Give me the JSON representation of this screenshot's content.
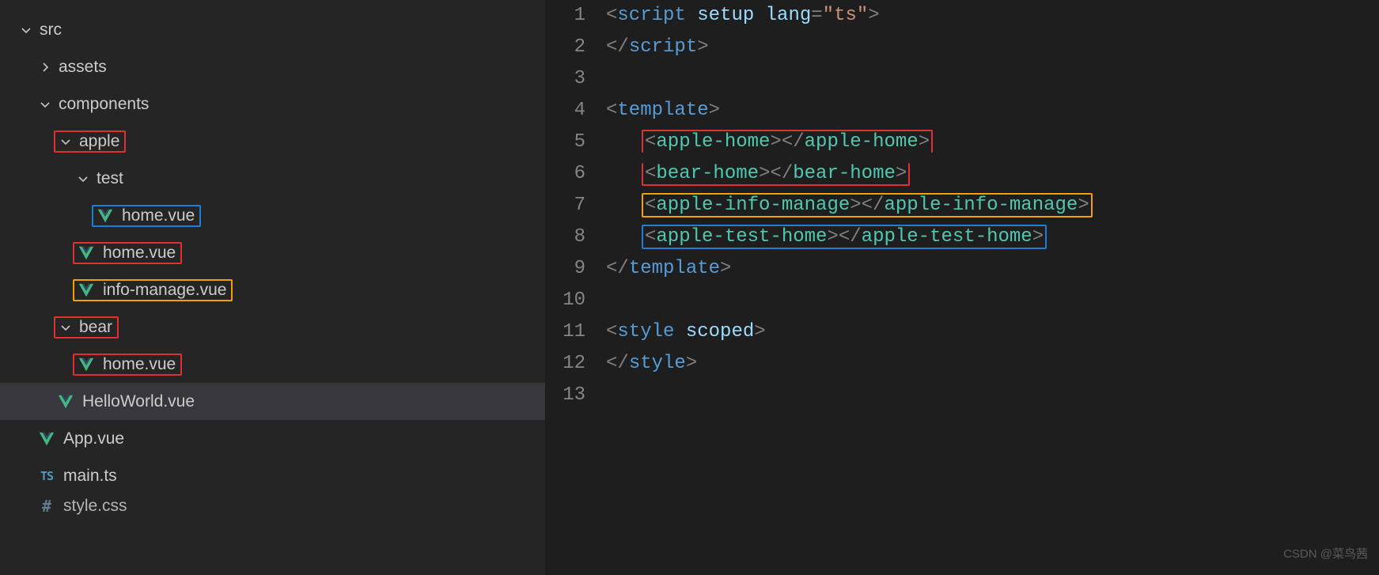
{
  "explorer": {
    "items": [
      {
        "type": "folder",
        "label": "src",
        "depth": 0,
        "expanded": true,
        "hl": null
      },
      {
        "type": "folder",
        "label": "assets",
        "depth": 1,
        "expanded": false,
        "hl": null
      },
      {
        "type": "folder",
        "label": "components",
        "depth": 1,
        "expanded": true,
        "hl": null
      },
      {
        "type": "folder",
        "label": "apple",
        "depth": 2,
        "expanded": true,
        "hl": "red"
      },
      {
        "type": "folder",
        "label": "test",
        "depth": 3,
        "expanded": true,
        "hl": null
      },
      {
        "type": "file",
        "label": "home.vue",
        "depth": 4,
        "icon": "vue",
        "hl": "blue"
      },
      {
        "type": "file",
        "label": "home.vue",
        "depth": 3,
        "icon": "vue",
        "hl": "red"
      },
      {
        "type": "file",
        "label": "info-manage.vue",
        "depth": 3,
        "icon": "vue",
        "hl": "yellow"
      },
      {
        "type": "folder",
        "label": "bear",
        "depth": 2,
        "expanded": true,
        "hl": "red"
      },
      {
        "type": "file",
        "label": "home.vue",
        "depth": 3,
        "icon": "vue",
        "hl": "red"
      },
      {
        "type": "file",
        "label": "HelloWorld.vue",
        "depth": 2,
        "icon": "vue",
        "hl": null,
        "selected": true
      },
      {
        "type": "file",
        "label": "App.vue",
        "depth": 1,
        "icon": "vue",
        "hl": null
      },
      {
        "type": "file",
        "label": "main.ts",
        "depth": 1,
        "icon": "ts",
        "hl": null
      },
      {
        "type": "file",
        "label": "style.css",
        "depth": 1,
        "icon": "hash",
        "hl": null,
        "cut": true
      }
    ]
  },
  "editor": {
    "lines": [
      {
        "n": 1,
        "segs": [
          {
            "t": "<",
            "c": "pun"
          },
          {
            "t": "script",
            "c": "tag"
          },
          {
            "t": " "
          },
          {
            "t": "setup",
            "c": "attn"
          },
          {
            "t": " "
          },
          {
            "t": "lang",
            "c": "attn"
          },
          {
            "t": "=",
            "c": "pun"
          },
          {
            "t": "\"ts\"",
            "c": "attv"
          },
          {
            "t": ">",
            "c": "pun"
          }
        ]
      },
      {
        "n": 2,
        "segs": [
          {
            "t": "</",
            "c": "pun"
          },
          {
            "t": "script",
            "c": "tag"
          },
          {
            "t": ">",
            "c": "pun"
          }
        ]
      },
      {
        "n": 3,
        "segs": []
      },
      {
        "n": 4,
        "segs": [
          {
            "t": "<",
            "c": "pun"
          },
          {
            "t": "template",
            "c": "tag"
          },
          {
            "t": ">",
            "c": "pun"
          }
        ]
      },
      {
        "n": 5,
        "guide": true,
        "indent": 1,
        "box": "red",
        "segs": [
          {
            "t": "<",
            "c": "pun"
          },
          {
            "t": "apple-home",
            "c": "comp"
          },
          {
            "t": "></",
            "c": "pun"
          },
          {
            "t": "apple-home",
            "c": "comp"
          },
          {
            "t": ">",
            "c": "pun"
          }
        ]
      },
      {
        "n": 6,
        "guide": true,
        "indent": 1,
        "box": "red",
        "joinPrev": true,
        "segs": [
          {
            "t": "<",
            "c": "pun"
          },
          {
            "t": "bear-home",
            "c": "comp"
          },
          {
            "t": "></",
            "c": "pun"
          },
          {
            "t": "bear-home",
            "c": "comp"
          },
          {
            "t": ">",
            "c": "pun"
          }
        ]
      },
      {
        "n": 7,
        "guide": true,
        "indent": 1,
        "box": "yellow",
        "segs": [
          {
            "t": "<",
            "c": "pun"
          },
          {
            "t": "apple-info-manage",
            "c": "comp"
          },
          {
            "t": "></",
            "c": "pun"
          },
          {
            "t": "apple-info-manage",
            "c": "comp"
          },
          {
            "t": ">",
            "c": "pun"
          }
        ]
      },
      {
        "n": 8,
        "guide": true,
        "indent": 1,
        "box": "blue",
        "segs": [
          {
            "t": "<",
            "c": "pun"
          },
          {
            "t": "apple-test-home",
            "c": "comp"
          },
          {
            "t": "></",
            "c": "pun"
          },
          {
            "t": "apple-test-home",
            "c": "comp"
          },
          {
            "t": ">",
            "c": "pun"
          }
        ]
      },
      {
        "n": 9,
        "segs": [
          {
            "t": "</",
            "c": "pun"
          },
          {
            "t": "template",
            "c": "tag"
          },
          {
            "t": ">",
            "c": "pun"
          }
        ]
      },
      {
        "n": 10,
        "segs": []
      },
      {
        "n": 11,
        "segs": [
          {
            "t": "<",
            "c": "pun"
          },
          {
            "t": "style",
            "c": "tag"
          },
          {
            "t": " "
          },
          {
            "t": "scoped",
            "c": "attn"
          },
          {
            "t": ">",
            "c": "pun"
          }
        ]
      },
      {
        "n": 12,
        "segs": [
          {
            "t": "</",
            "c": "pun"
          },
          {
            "t": "style",
            "c": "tag"
          },
          {
            "t": ">",
            "c": "pun"
          }
        ]
      },
      {
        "n": 13,
        "segs": []
      }
    ]
  },
  "watermark": "CSDN @菜鸟茜"
}
